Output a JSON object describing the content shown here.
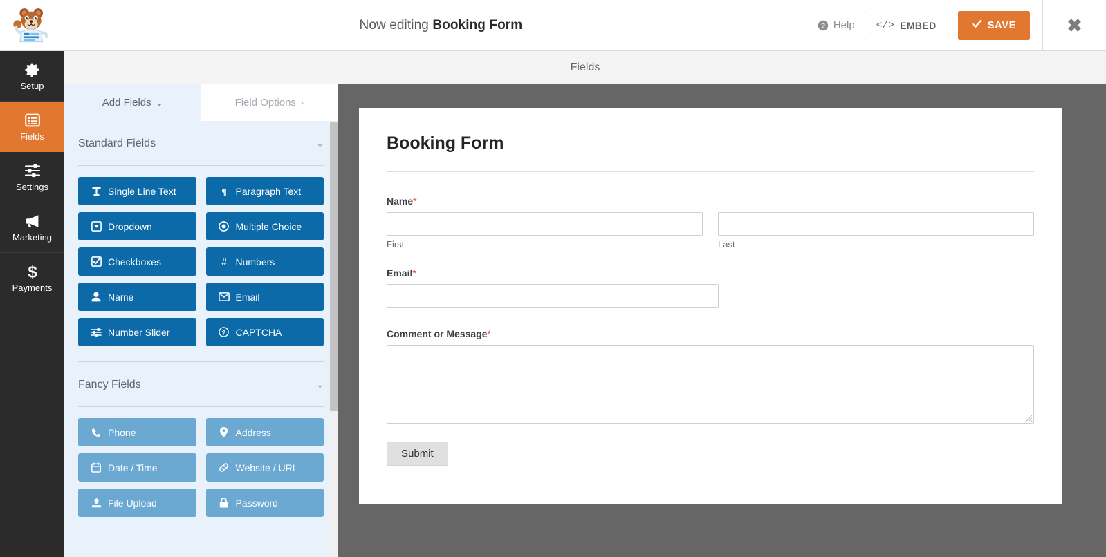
{
  "header": {
    "logo_name": "wpforms-bear-logo",
    "editing_prefix": "Now editing",
    "form_name": "Booking Form",
    "help_label": "Help",
    "embed_label": "EMBED",
    "embed_icon_text": "</>",
    "save_label": "SAVE",
    "close_label": "✖"
  },
  "subheader": {
    "title": "Fields"
  },
  "sidebar": {
    "items": [
      {
        "label": "Setup",
        "icon": "gear-icon",
        "active": false
      },
      {
        "label": "Fields",
        "icon": "list-icon",
        "active": true
      },
      {
        "label": "Settings",
        "icon": "sliders-icon",
        "active": false
      },
      {
        "label": "Marketing",
        "icon": "megaphone-icon",
        "active": false
      },
      {
        "label": "Payments",
        "icon": "dollar-icon",
        "active": false
      }
    ]
  },
  "panel": {
    "tabs": [
      {
        "label": "Add Fields",
        "chevron": "⌄",
        "active": true
      },
      {
        "label": "Field Options",
        "chevron": "›",
        "active": false
      }
    ],
    "groups": [
      {
        "title": "Standard Fields",
        "chevron": "⌄",
        "style": "standard",
        "fields": [
          {
            "label": "Single Line Text",
            "icon": "text-cursor-icon"
          },
          {
            "label": "Paragraph Text",
            "icon": "pilcrow-icon"
          },
          {
            "label": "Dropdown",
            "icon": "dropdown-icon"
          },
          {
            "label": "Multiple Choice",
            "icon": "radio-icon"
          },
          {
            "label": "Checkboxes",
            "icon": "checkbox-icon"
          },
          {
            "label": "Numbers",
            "icon": "hash-icon"
          },
          {
            "label": "Name",
            "icon": "user-icon"
          },
          {
            "label": "Email",
            "icon": "envelope-icon"
          },
          {
            "label": "Number Slider",
            "icon": "slider-icon"
          },
          {
            "label": "CAPTCHA",
            "icon": "question-circle-icon"
          }
        ]
      },
      {
        "title": "Fancy Fields",
        "chevron": "⌄",
        "style": "fancy",
        "fields": [
          {
            "label": "Phone",
            "icon": "phone-icon"
          },
          {
            "label": "Address",
            "icon": "map-pin-icon"
          },
          {
            "label": "Date / Time",
            "icon": "calendar-icon"
          },
          {
            "label": "Website / URL",
            "icon": "link-icon"
          },
          {
            "label": "File Upload",
            "icon": "upload-icon"
          },
          {
            "label": "Password",
            "icon": "lock-icon"
          }
        ]
      }
    ]
  },
  "form_preview": {
    "title": "Booking Form",
    "required_marker": "*",
    "fields": [
      {
        "label": "Name",
        "required": true,
        "type": "name",
        "subfields": [
          {
            "sublabel": "First",
            "value": "",
            "placeholder": ""
          },
          {
            "sublabel": "Last",
            "value": "",
            "placeholder": ""
          }
        ]
      },
      {
        "label": "Email",
        "required": true,
        "type": "email",
        "value": "",
        "placeholder": ""
      },
      {
        "label": "Comment or Message",
        "required": true,
        "type": "textarea",
        "value": "",
        "placeholder": ""
      }
    ],
    "submit_label": "Submit"
  },
  "colors": {
    "accent_orange": "#e27730",
    "standard_blue": "#0d6aa8",
    "fancy_blue": "#6ba9d3",
    "panel_bg": "#e9f2fb",
    "rail_bg": "#2b2b2b",
    "preview_bg": "#666666",
    "required_red": "#e2401c"
  }
}
